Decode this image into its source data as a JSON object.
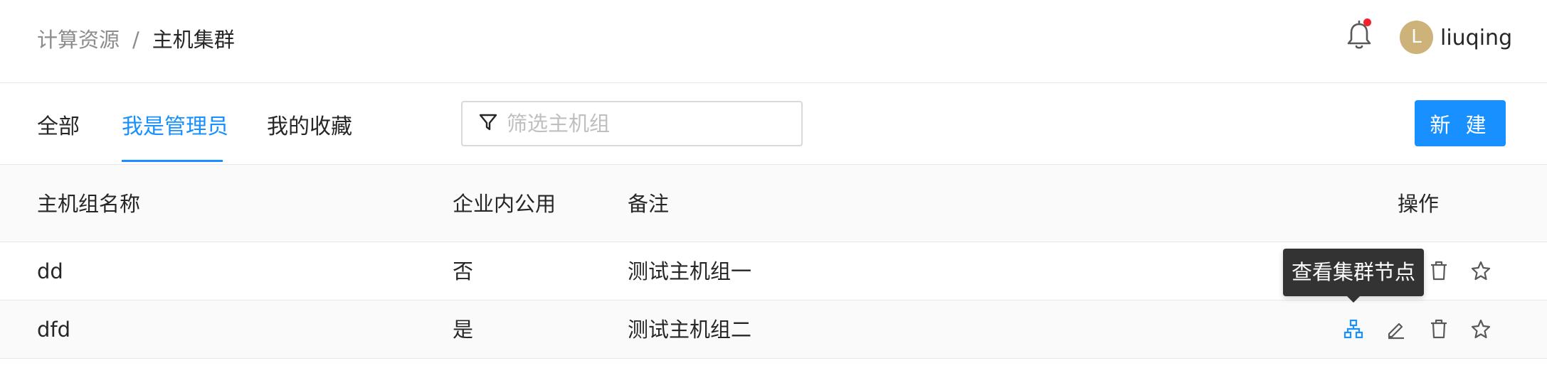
{
  "breadcrumb": {
    "parent": "计算资源",
    "separator": "/",
    "current": "主机集群"
  },
  "user": {
    "avatar_letter": "L",
    "name": "liuqing"
  },
  "tabs": [
    {
      "label": "全部",
      "active": false
    },
    {
      "label": "我是管理员",
      "active": true
    },
    {
      "label": "我的收藏",
      "active": false
    }
  ],
  "filter": {
    "placeholder": "筛选主机组",
    "value": ""
  },
  "new_button": "新 建",
  "table": {
    "columns": [
      "主机组名称",
      "企业内公用",
      "备注",
      "操作"
    ],
    "rows": [
      {
        "name": "dd",
        "public": "否",
        "remark": "测试主机组一"
      },
      {
        "name": "dfd",
        "public": "是",
        "remark": "测试主机组二"
      }
    ]
  },
  "tooltip": "查看集群节点",
  "colors": {
    "accent": "#1890ff",
    "notification_dot": "#f5222d",
    "avatar": "#cdb27a",
    "tooltip_bg": "#333333"
  },
  "icons": [
    "bell-icon",
    "filter-icon",
    "cluster-icon",
    "edit-icon",
    "delete-icon",
    "star-icon"
  ]
}
